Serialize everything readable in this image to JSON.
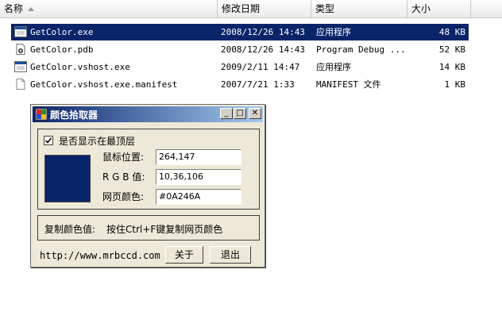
{
  "columns": {
    "name": "名称",
    "modified": "修改日期",
    "type": "类型",
    "size": "大小"
  },
  "files": [
    {
      "name": "GetColor.exe",
      "modified": "2008/12/26 14:43",
      "type": "应用程序",
      "size": "48 KB",
      "icon": "exe-icon",
      "selected": true
    },
    {
      "name": "GetColor.pdb",
      "modified": "2008/12/26 14:43",
      "type": "Program Debug ...",
      "size": "52 KB",
      "icon": "pdb-icon",
      "selected": false
    },
    {
      "name": "GetColor.vshost.exe",
      "modified": "2009/2/11 14:47",
      "type": "应用程序",
      "size": "14 KB",
      "icon": "exe-icon",
      "selected": false
    },
    {
      "name": "GetColor.vshost.exe.manifest",
      "modified": "2007/7/21 1:33",
      "type": "MANIFEST 文件",
      "size": "1 KB",
      "icon": "file-icon",
      "selected": false
    }
  ],
  "dialog": {
    "title": "颜色拾取器",
    "topmost_label": "是否显示在最顶层",
    "topmost_checked": true,
    "mouse_pos_label": "鼠标位置:",
    "mouse_pos_value": "264,147",
    "rgb_label": "R G B 值:",
    "rgb_value": "10,36,106",
    "web_color_label": "网页颜色:",
    "web_color_value": "#0A246A",
    "swatch_color": "#0a246a",
    "copy_label": "复制颜色值:",
    "copy_hint": "按住Ctrl+F键复制网页颜色",
    "url": "http://www.mrbccd.com",
    "about_button": "关于",
    "exit_button": "退出",
    "minimize_glyph": "_",
    "maximize_glyph": "□",
    "close_glyph": "✕"
  }
}
